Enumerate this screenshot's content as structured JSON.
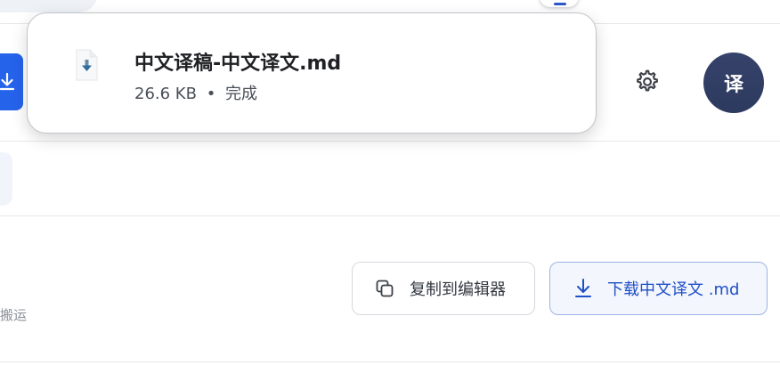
{
  "download_popup": {
    "file_name": "中文译稿-中文译文.md",
    "file_size": "26.6 KB",
    "separator": "•",
    "status": "完成"
  },
  "header": {
    "avatar_text": "译"
  },
  "actions": {
    "copy_label": "复制到编辑器",
    "download_label": "下载中文译文 .md"
  },
  "footnote": {
    "text": "搬运"
  },
  "colors": {
    "primary": "#2563eb",
    "avatar_bg": "#2d3a5f",
    "download_btn_bg": "#f3f6fd",
    "download_btn_border": "#9db3ea"
  }
}
